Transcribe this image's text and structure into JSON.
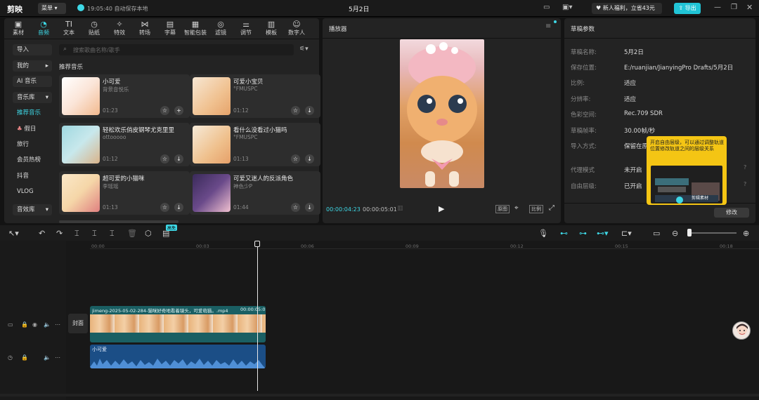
{
  "app": {
    "logo": "剪映",
    "menu_label": "菜单",
    "autosave": "19:05:40 自动保存本地",
    "project_title": "5月2日",
    "promo": "新人福利，立省43元",
    "export_label": "导出"
  },
  "tabs": [
    {
      "label": "素材",
      "icon": "▣"
    },
    {
      "label": "音频",
      "icon": "◔"
    },
    {
      "label": "文本",
      "icon": "TI"
    },
    {
      "label": "贴纸",
      "icon": "◷"
    },
    {
      "label": "特效",
      "icon": "✧"
    },
    {
      "label": "转场",
      "icon": "⋈"
    },
    {
      "label": "字幕",
      "icon": "▤"
    },
    {
      "label": "智能包装",
      "icon": "▦"
    },
    {
      "label": "滤镜",
      "icon": "◎"
    },
    {
      "label": "调节",
      "icon": "⚌"
    },
    {
      "label": "模板",
      "icon": "▥"
    },
    {
      "label": "数字人",
      "icon": "☺"
    }
  ],
  "sidebar": {
    "import": "导入",
    "mine": "我的",
    "ai_music": "AI 音乐",
    "library": "音乐库",
    "recommended": "推荐音乐",
    "holiday": "假日",
    "travel": "旅行",
    "member_hot": "会员热榜",
    "douyin": "抖音",
    "vlog": "VLOG",
    "sfx": "音效库"
  },
  "search": {
    "placeholder": "搜索歌曲名称/歌手"
  },
  "section_title": "推荐音乐",
  "music": [
    {
      "title": "小可爱",
      "artist": "背景音悦乐",
      "duration": "01:23"
    },
    {
      "title": "可爱小宝贝",
      "artist": "°FMUSPC",
      "duration": "01:12"
    },
    {
      "title": "轻松欢乐俏皮钢琴尤克里里",
      "artist": "ottooooo",
      "duration": "01:12"
    },
    {
      "title": "看什么没看过小猫吗",
      "artist": "°FMUSPC",
      "duration": "01:13"
    },
    {
      "title": "超可爱的小猫咪",
      "artist": "李瑶瑶",
      "duration": "01:13"
    },
    {
      "title": "可爱又迷人的反派角色",
      "artist": "神色少P",
      "duration": "01:44"
    }
  ],
  "player": {
    "title": "播放器",
    "current": "00:00:04:23",
    "total": "00:00:05:01",
    "btn1": "原图",
    "btn2": "比例"
  },
  "draft": {
    "title": "草稿参数",
    "rows": [
      {
        "label": "草稿名称:",
        "value": "5月2日"
      },
      {
        "label": "保存位置:",
        "value": "E:/ruanjian/JianyingPro Drafts/5月2日"
      },
      {
        "label": "比例:",
        "value": "适应"
      },
      {
        "label": "分辨率:",
        "value": "适应"
      },
      {
        "label": "色彩空间:",
        "value": "Rec.709 SDR"
      },
      {
        "label": "草稿帧率:",
        "value": "30.00帧/秒"
      },
      {
        "label": "导入方式:",
        "value": "保留在原"
      },
      {
        "label": "代理模式",
        "value": "未开启"
      },
      {
        "label": "自由层级:",
        "value": "已开启"
      }
    ],
    "tooltip": "开启自由层级，可以通过调整轨道位置修改轨道之间的层级关系",
    "tooltip_thumb": "剪辑素材",
    "modify": "修改"
  },
  "timeline": {
    "ticks": [
      "00:00",
      "00:03",
      "00:06",
      "00:09",
      "00:12",
      "00:15",
      "00:18"
    ],
    "cover": "封面",
    "video_clip": "jimeng-2025-05-02-284-猫咪好奇地看着镜头，可爱萌猫。.mp4",
    "video_clip_dur": "00:00:05:0",
    "audio_clip": "小可爱",
    "badge": "高免"
  },
  "colors": {
    "accent": "#3ed8e6",
    "video_track": "#1a5f63",
    "audio_track": "#1b4e86"
  }
}
